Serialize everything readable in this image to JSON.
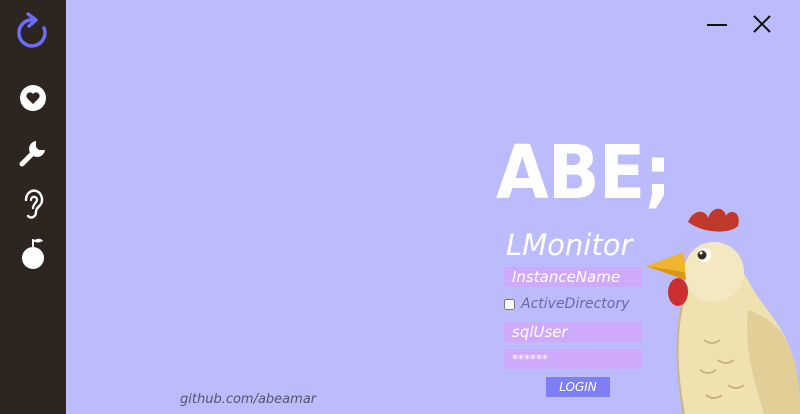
{
  "sidebar": {
    "items": [
      {
        "icon": "refresh-icon"
      },
      {
        "icon": "heart-icon"
      },
      {
        "icon": "wrench-icon"
      },
      {
        "icon": "ear-icon"
      },
      {
        "icon": "fruit-icon"
      }
    ]
  },
  "window": {
    "minimize_icon": "minimize-icon",
    "close_icon": "close-icon"
  },
  "brand": {
    "logo": "ABE;",
    "app_name": "LMonitor"
  },
  "login_form": {
    "instance_placeholder": "InstanceName",
    "active_directory_label": "ActiveDirectory",
    "active_directory_checked": false,
    "user_value": "sqlUser",
    "password_value": "******",
    "login_label": "LOGIN"
  },
  "footer": {
    "github": "github.com/abeamar"
  },
  "colors": {
    "background": "#bcbcfc",
    "sidebar": "#2d2620",
    "field": "#cfaafc",
    "button": "#7f7ff5",
    "accent_icon": "#6c6cff"
  }
}
